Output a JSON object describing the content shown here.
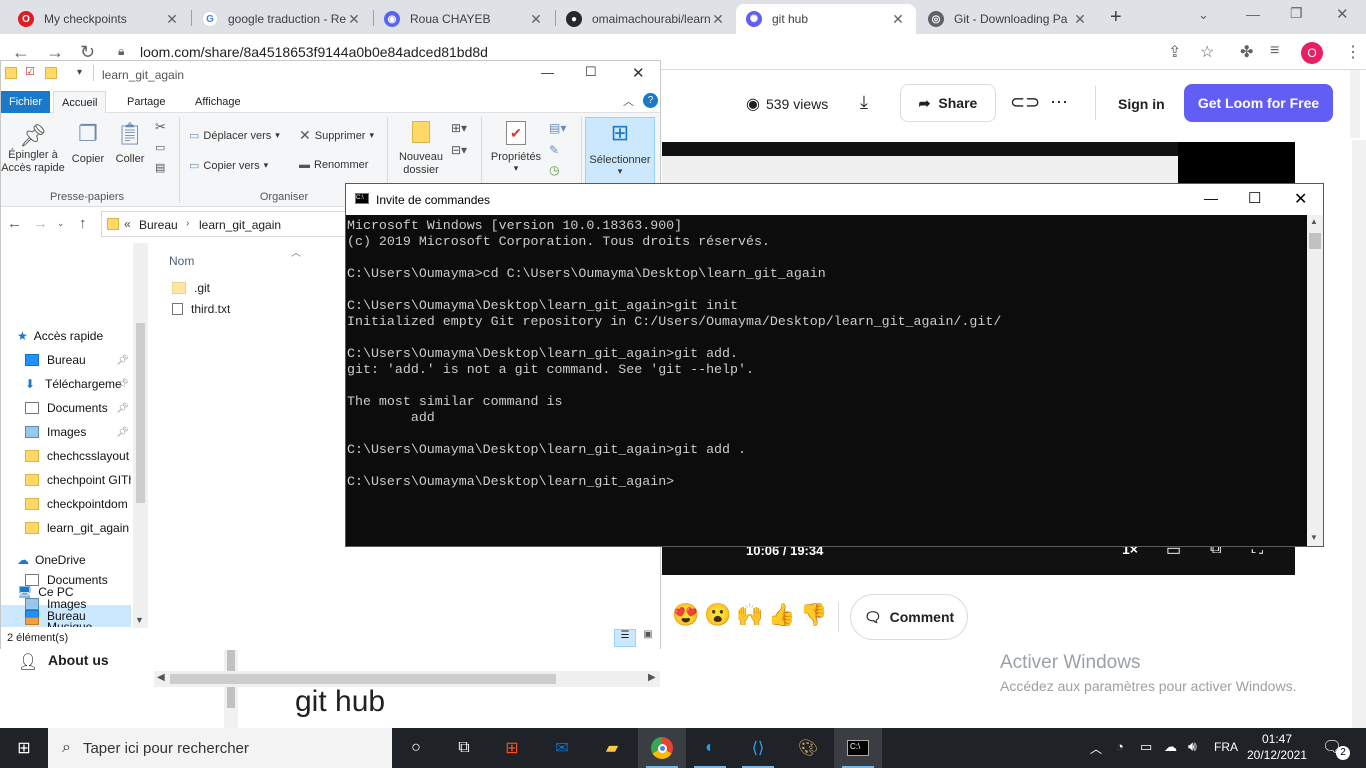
{
  "browser": {
    "tabs": [
      {
        "title": "My checkpoints",
        "icon": "opera-icon",
        "color": "#e01b24"
      },
      {
        "title": "google traduction - Re",
        "icon": "google-icon",
        "color": "#4285f4"
      },
      {
        "title": "Roua CHAYEB",
        "icon": "discord-icon",
        "color": "#5865f2"
      },
      {
        "title": "omaimachourabi/learn",
        "icon": "github-icon",
        "color": "#24292e"
      },
      {
        "title": "git hub",
        "icon": "loom-icon",
        "color": "#625df5"
      },
      {
        "title": "Git - Downloading Pa",
        "icon": "globe-icon",
        "color": "#5f6368"
      }
    ],
    "url": "loom.com/share/8a4518653f9144a0b0e84adced81bd8d",
    "profile_initial": "O"
  },
  "loom": {
    "views": "539 views",
    "share_label": "Share",
    "signin_label": "Sign in",
    "cta_label": "Get Loom for Free",
    "video_time": "10:06 / 19:34",
    "speed": "1×",
    "reactions": [
      "😍",
      "😮",
      "🙌",
      "👍",
      "👎"
    ],
    "comment_label": "Comment",
    "about_label": "About us",
    "page_title": "git hub",
    "activate_title": "Activer Windows",
    "activate_sub": "Accédez aux paramètres pour activer Windows.",
    "accent": "#625df5"
  },
  "explorer": {
    "title": "learn_git_again",
    "ribbon_tabs": [
      "Fichier",
      "Accueil",
      "Partage",
      "Affichage"
    ],
    "ribbon": {
      "pin": "Épingler à\nAccès rapide",
      "copy": "Copier",
      "paste": "Coller",
      "clipboard_group": "Presse-papiers",
      "move_to": "Déplacer vers",
      "copy_to": "Copier vers",
      "delete": "Supprimer",
      "rename": "Renommer",
      "organize_group": "Organiser",
      "new_folder": "Nouveau\ndossier",
      "properties": "Propriétés",
      "select": "Sélectionner"
    },
    "breadcrumb": [
      "Bureau",
      "learn_git_again"
    ],
    "nav": {
      "quick_access": "Accès rapide",
      "quick_items": [
        "Bureau",
        "Téléchargeme",
        "Documents",
        "Images",
        "chechcsslayout",
        "chechpoint GITh",
        "checkpointdom",
        "learn_git_again"
      ],
      "onedrive": "OneDrive",
      "this_pc": "Ce PC",
      "pc_items": [
        "Bureau",
        "Documents",
        "Images",
        "Musique"
      ]
    },
    "column_name": "Nom",
    "files": [
      ".git",
      "third.txt"
    ],
    "status": "2 élément(s)"
  },
  "cmd": {
    "title": "Invite de commandes",
    "lines": [
      "Microsoft Windows [version 10.0.18363.900]",
      "(c) 2019 Microsoft Corporation. Tous droits réservés.",
      "",
      "C:\\Users\\Oumayma>cd C:\\Users\\Oumayma\\Desktop\\learn_git_again",
      "",
      "C:\\Users\\Oumayma\\Desktop\\learn_git_again>git init",
      "Initialized empty Git repository in C:/Users/Oumayma/Desktop/learn_git_again/.git/",
      "",
      "C:\\Users\\Oumayma\\Desktop\\learn_git_again>git add.",
      "git: 'add.' is not a git command. See 'git --help'.",
      "",
      "The most similar command is",
      "        add",
      "",
      "C:\\Users\\Oumayma\\Desktop\\learn_git_again>git add .",
      "",
      "C:\\Users\\Oumayma\\Desktop\\learn_git_again>"
    ]
  },
  "taskbar": {
    "search_placeholder": "Taper ici pour rechercher",
    "lang": "FRA",
    "time": "01:47",
    "date": "20/12/2021",
    "notifications": "2"
  }
}
